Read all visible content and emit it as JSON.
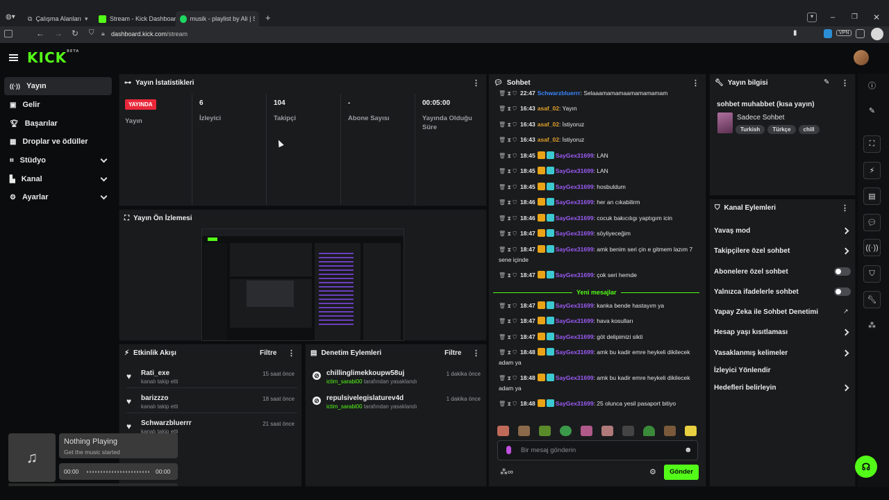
{
  "browser": {
    "tabs": [
      {
        "label": "Çalışma Alanları"
      },
      {
        "label": "Stream - Kick Dashboard"
      },
      {
        "label": "musik - playlist by Ali | Spo"
      }
    ],
    "new_tab": "+",
    "url_domain": "dashboard.kick.com",
    "url_path": "/stream",
    "vpn_label": "VPN"
  },
  "app": {
    "logo": "KICK",
    "logo_sup": "BETA"
  },
  "sidebar": {
    "items": [
      {
        "label": "Yayın",
        "icon": "broadcast-icon"
      },
      {
        "label": "Gelir",
        "icon": "wallet-icon"
      },
      {
        "label": "Başarılar",
        "icon": "trophy-icon"
      },
      {
        "label": "Droplar ve ödüller",
        "icon": "gift-icon"
      },
      {
        "label": "Stüdyo",
        "icon": "studio-icon"
      },
      {
        "label": "Kanal",
        "icon": "channel-icon"
      },
      {
        "label": "Ayarlar",
        "icon": "gear-icon"
      }
    ]
  },
  "stats": {
    "title": "Yayın İstatistikleri",
    "live_badge": "YAYINDA",
    "live_label": "Yayın",
    "items": [
      {
        "value": "6",
        "label": "İzleyici"
      },
      {
        "value": "104",
        "label": "Takipçi"
      },
      {
        "value": "-",
        "label": "Abone Sayısı"
      },
      {
        "value": "00:05:00",
        "label": "Yayında Olduğu Süre"
      }
    ]
  },
  "preview": {
    "title": "Yayın Ön İzlemesi"
  },
  "activity": {
    "title": "Etkinlik Akışı",
    "filter": "Filtre",
    "items": [
      {
        "name": "Rati_exe",
        "sub": "kanalı takip etti",
        "time": "15 saat önce"
      },
      {
        "name": "barizzzo",
        "sub": "kanalı takip etti",
        "time": "18 saat önce"
      },
      {
        "name": "Schwarzbluerrr",
        "sub": "kanalı takip etti",
        "time": "21 saat önce"
      }
    ]
  },
  "moderation": {
    "title": "Denetim Eylemleri",
    "filter": "Filtre",
    "items": [
      {
        "name": "chillinglimekkoupw58uj",
        "by": "ictim_sarabi00",
        "suffix": "tarafından yasaklandı",
        "time": "1 dakika önce"
      },
      {
        "name": "repulsivelegislaturev4d",
        "by": "ictim_sarabi00",
        "suffix": "tarafından yasaklandı",
        "time": "1 dakika önce"
      }
    ]
  },
  "chat": {
    "title": "Sohbet",
    "messages": [
      {
        "time": "22:47",
        "user": "Schwarzbluerrr",
        "text": ": Selaaamamamaamamamamam",
        "style": "u3",
        "badges": false
      },
      {
        "time": "16:43",
        "user": "asaf_02",
        "text": ": Yayın",
        "style": "u1",
        "badges": false
      },
      {
        "time": "16:43",
        "user": "asaf_02",
        "text": ": İstiyoruz",
        "style": "u1",
        "badges": false
      },
      {
        "time": "16:43",
        "user": "asaf_02",
        "text": ": İstiyoruz",
        "style": "u1",
        "badges": false
      },
      {
        "time": "18:45",
        "user": "SayGex31699",
        "text": ": LAN",
        "style": "u2",
        "badges": true
      },
      {
        "time": "18:45",
        "user": "SayGex31699",
        "text": ": LAN",
        "style": "u2",
        "badges": true
      },
      {
        "time": "18:45",
        "user": "SayGex31699",
        "text": ": hosbuldum",
        "style": "u2",
        "badges": true
      },
      {
        "time": "18:46",
        "user": "SayGex31699",
        "text": ": her an cıkabilirm",
        "style": "u2",
        "badges": true
      },
      {
        "time": "18:46",
        "user": "SayGex31699",
        "text": ": cocuk bakıcılıgı yaptıgım icin",
        "style": "u2",
        "badges": true
      },
      {
        "time": "18:47",
        "user": "SayGex31699",
        "text": ": söyliyeceğim",
        "style": "u2",
        "badges": true
      },
      {
        "time": "18:47",
        "user": "SayGex31699",
        "text": ": amk benim seri çin e gitmem lazım 7 sene içinde",
        "style": "u2",
        "badges": true
      },
      {
        "time": "18:47",
        "user": "SayGex31699",
        "text": ": çok seri hemde",
        "style": "u2",
        "badges": true
      },
      {
        "time": "18:47",
        "user": "SayGex31699",
        "text": ": kanka bende hastayım ya",
        "style": "u2",
        "badges": true
      },
      {
        "time": "18:47",
        "user": "SayGex31699",
        "text": ": hava kosulları",
        "style": "u2",
        "badges": true
      },
      {
        "time": "18:47",
        "user": "SayGex31699",
        "text": ": göt delipimizi sikti",
        "style": "u2",
        "badges": true
      },
      {
        "time": "18:48",
        "user": "SayGex31699",
        "text": ": amk bu kadir emre heykeli dikilecek adam ya",
        "style": "u2",
        "badges": true
      },
      {
        "time": "18:48",
        "user": "SayGex31699",
        "text": ": amk bu kadir emre heykeli dikilecek adam ya",
        "style": "u2",
        "badges": true
      },
      {
        "time": "18:48",
        "user": "SayGex31699",
        "text": ": 25 olunca yesil pasaport bitiyo",
        "style": "u2",
        "badges": true
      }
    ],
    "new_messages": "Yeni mesajlar",
    "input_placeholder": "Bir mesaj gönderin",
    "send": "Gönder"
  },
  "stream_info": {
    "title": "Yayın bilgisi",
    "stream_title": "sohbet muhabbet (kısa yayın)",
    "category": "Sadece Sohbet",
    "tags": [
      "Turkish",
      "Türkçe",
      "chill"
    ]
  },
  "channel_actions": {
    "title": "Kanal Eylemleri",
    "items": [
      {
        "label": "Yavaş mod",
        "control": "chevron"
      },
      {
        "label": "Takipçilere özel sohbet",
        "control": "chevron"
      },
      {
        "label": "Abonelere özel sohbet",
        "control": "toggle"
      },
      {
        "label": "Yalnızca ifadelerle sohbet",
        "control": "toggle"
      },
      {
        "label": "Yapay Zeka ile Sohbet Denetimi",
        "control": "external"
      },
      {
        "label": "Hesap yaşı kısıtlaması",
        "control": "chevron"
      },
      {
        "label": "Yasaklanmış kelimeler",
        "control": "chevron"
      },
      {
        "label": "İzleyici Yönlendir",
        "control": "none"
      },
      {
        "label": "Hedefleri belirleyin",
        "control": "chevron"
      }
    ]
  },
  "player": {
    "title": "Nothing Playing",
    "subtitle": "Get the music started",
    "time_start": "00:00",
    "time_end": "00:00",
    "progress": 0
  },
  "colors": {
    "brand": "#53fc18",
    "live": "#e8283a",
    "accent_purple": "#9b5cf6"
  }
}
